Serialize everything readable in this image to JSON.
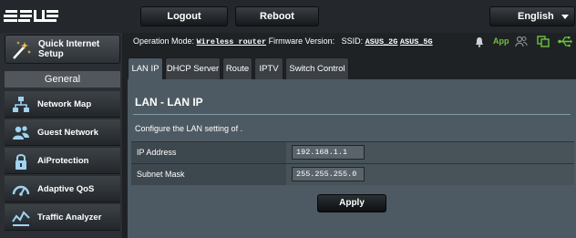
{
  "brand": {
    "logo_text": "/ISUS"
  },
  "header": {
    "logout_label": "Logout",
    "reboot_label": "Reboot",
    "language": "English"
  },
  "sidebar": {
    "quick_setup_label": "Quick Internet Setup",
    "section_label": "General",
    "items": [
      {
        "label": "Network Map",
        "icon": "network-map-icon"
      },
      {
        "label": "Guest Network",
        "icon": "guest-network-icon"
      },
      {
        "label": "AiProtection",
        "icon": "lock-icon"
      },
      {
        "label": "Adaptive QoS",
        "icon": "speedometer-icon"
      },
      {
        "label": "Traffic Analyzer",
        "icon": "traffic-analyzer-icon"
      }
    ]
  },
  "status": {
    "operation_mode_label": "Operation Mode:",
    "operation_mode_value": "Wireless router",
    "firmware_label": "Firmware Version:",
    "ssid_label": "SSID:",
    "ssid_2g": "ASUS_2G",
    "ssid_5g": "ASUS_5G",
    "app_label": "App",
    "accent_color": "#6fc13f"
  },
  "tabs": [
    {
      "label": "LAN IP",
      "active": true
    },
    {
      "label": "DHCP Server",
      "active": false
    },
    {
      "label": "Route",
      "active": false
    },
    {
      "label": "IPTV",
      "active": false
    },
    {
      "label": "Switch Control",
      "active": false
    }
  ],
  "panel": {
    "title": "LAN - LAN IP",
    "description": "Configure the LAN setting of .",
    "fields": [
      {
        "label": "IP Address",
        "value": "192.168.1.1"
      },
      {
        "label": "Subnet Mask",
        "value": "255.255.255.0"
      }
    ],
    "apply_label": "Apply"
  }
}
